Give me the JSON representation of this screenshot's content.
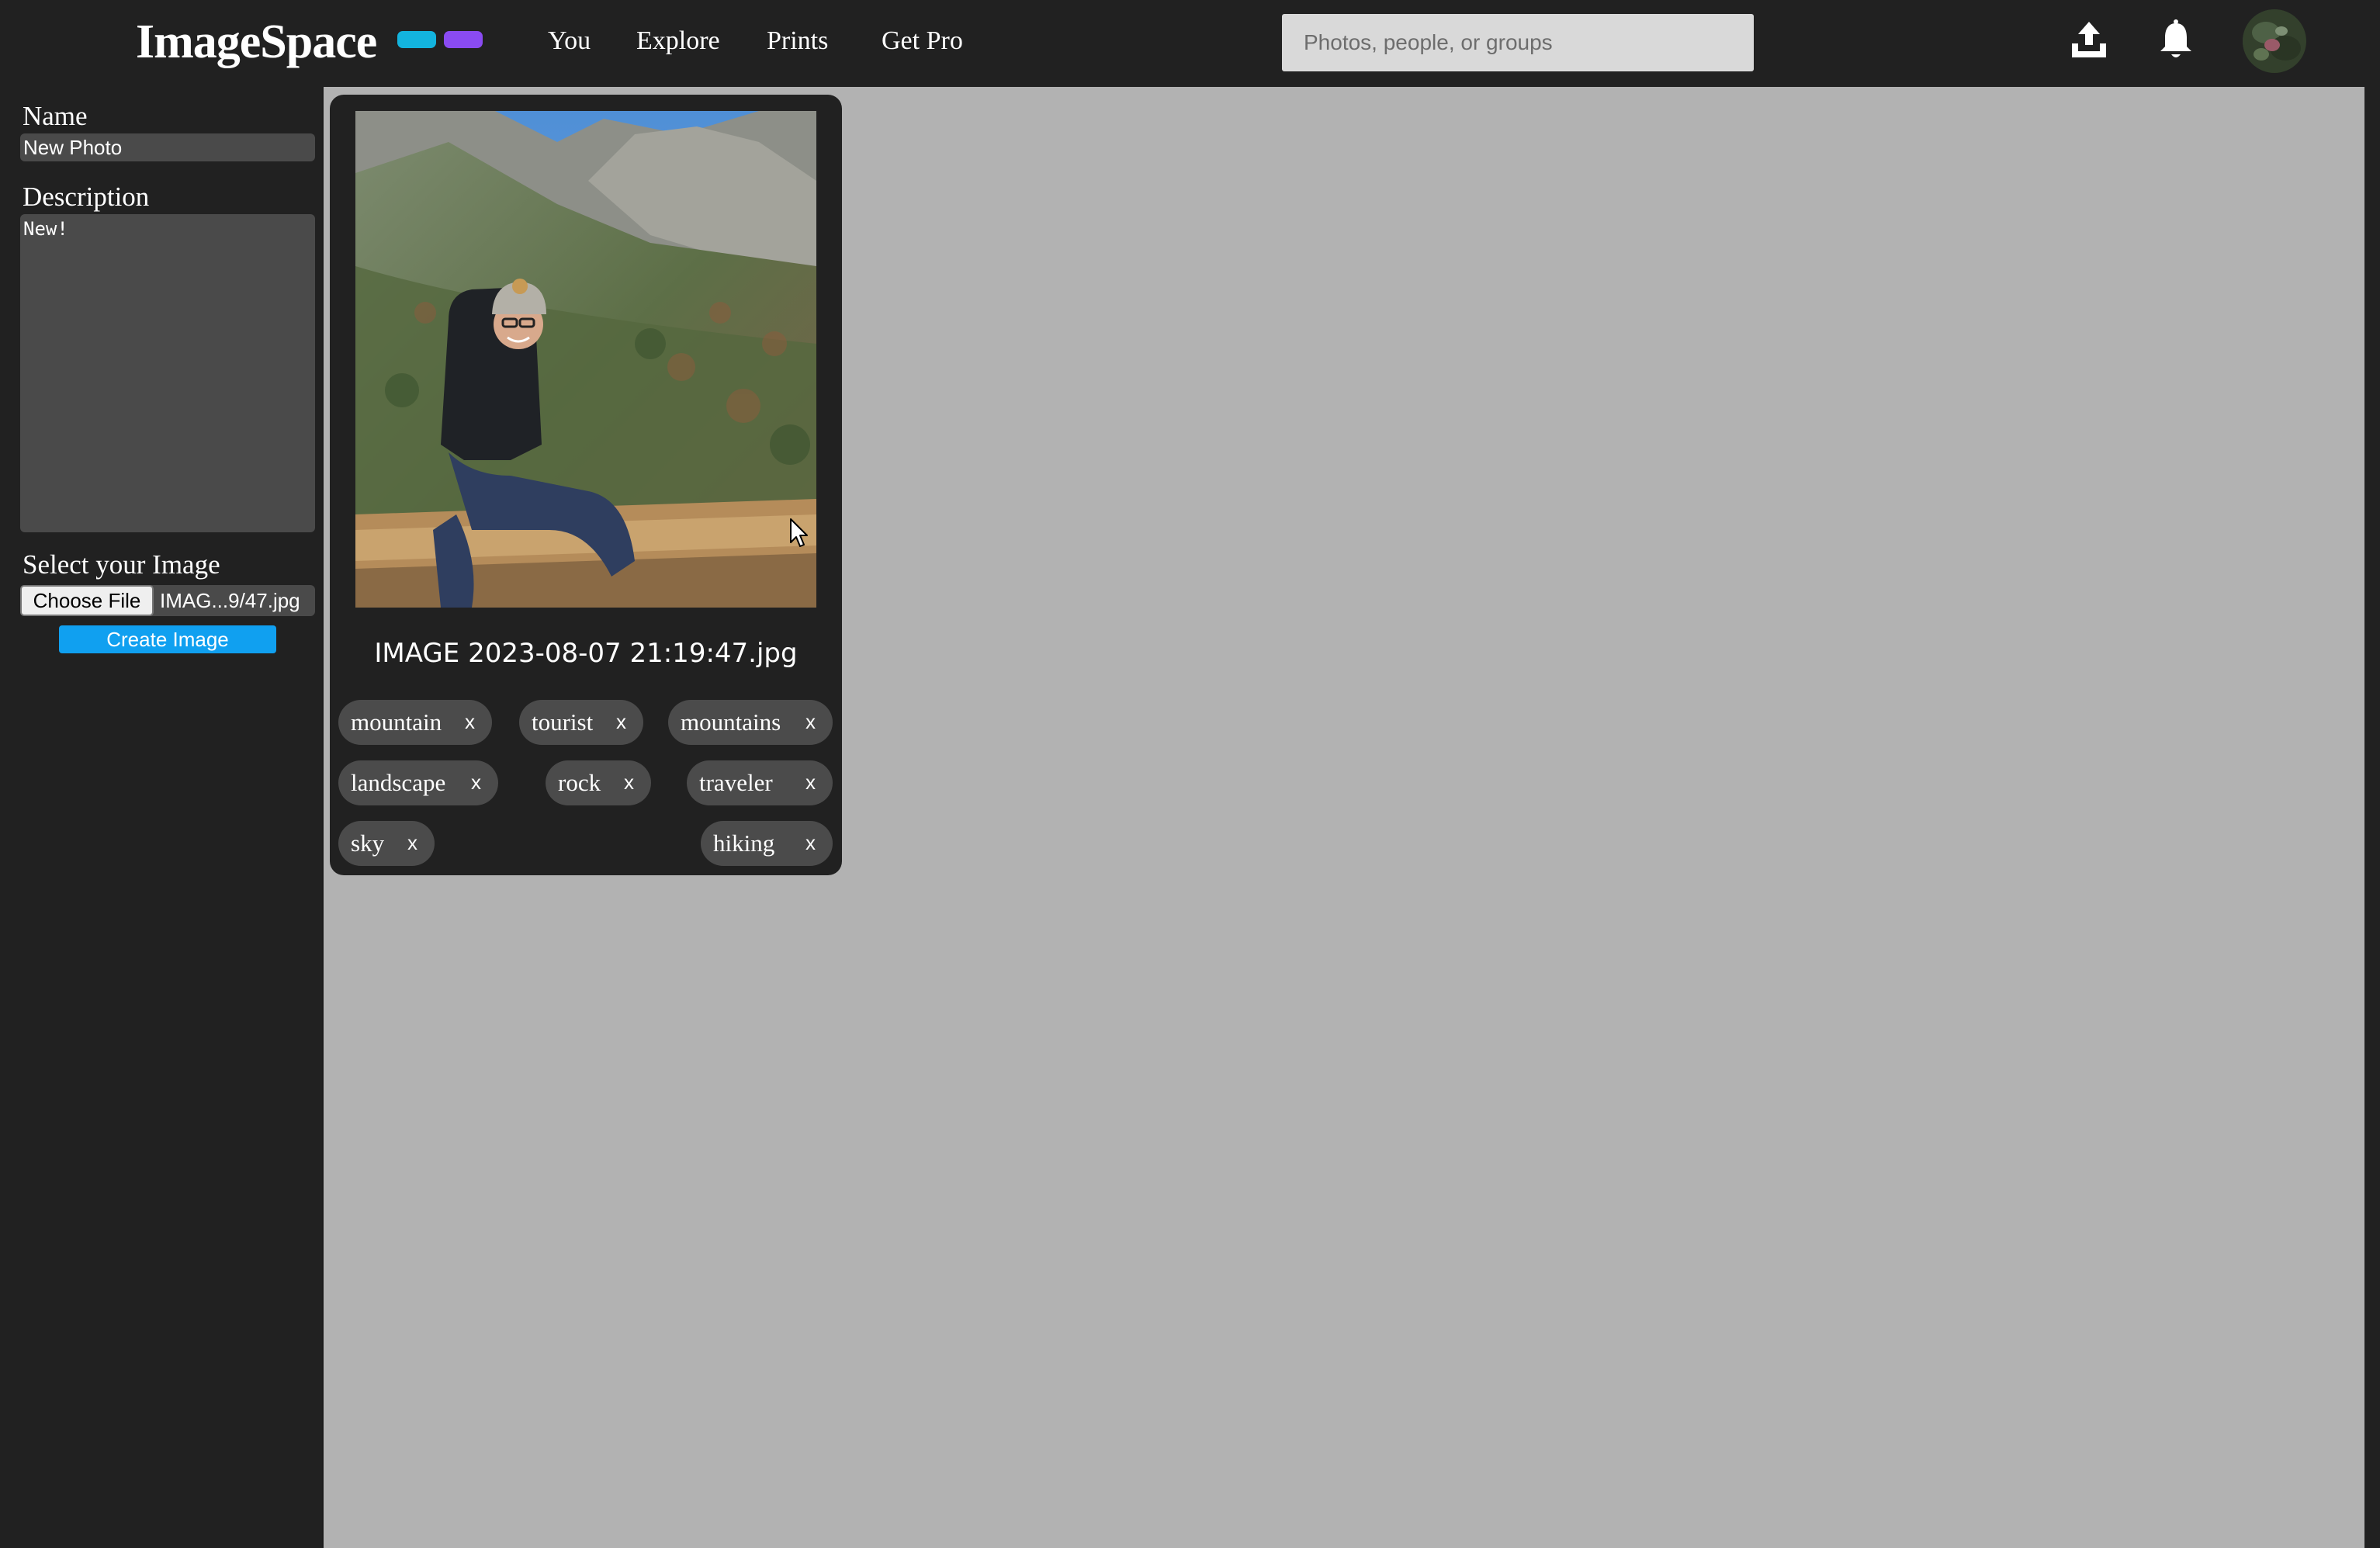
{
  "header": {
    "logo": "ImageSpace",
    "accent_colors": [
      "#13b4de",
      "#8a4bf2"
    ],
    "nav": [
      "You",
      "Explore",
      "Prints",
      "Get Pro"
    ],
    "search_placeholder": "Photos, people, or groups",
    "icons": [
      "upload-icon",
      "bell-icon"
    ],
    "avatar": "profile-avatar"
  },
  "sidebar": {
    "name_label": "Name",
    "name_value": "New Photo",
    "description_label": "Description",
    "description_value": "New!",
    "select_label": "Select your Image",
    "choose_file_label": "Choose File",
    "file_name": "IMAG...9/47.jpg",
    "create_button": "Create Image",
    "create_button_color": "#10a0f0"
  },
  "main": {
    "background": "#b2b2b2",
    "card": {
      "caption": "IMAGE 2023-08-07 21:19:47.jpg",
      "tags": [
        "mountain",
        "tourist",
        "mountains",
        "landscape",
        "rock",
        "traveler",
        "sky",
        "hiking"
      ],
      "remove_symbol": "x"
    }
  }
}
